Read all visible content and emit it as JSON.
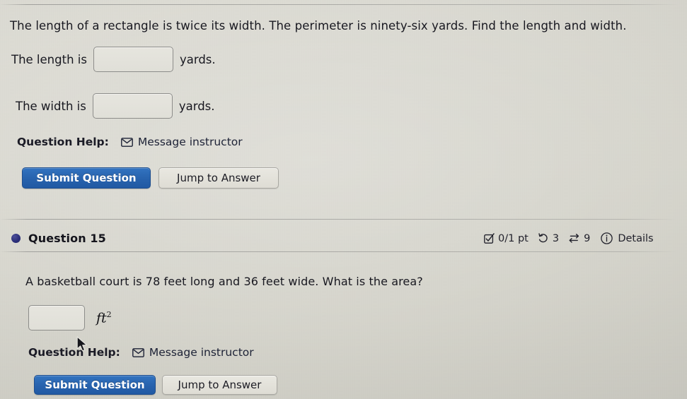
{
  "app": {
    "background_color": "#d7d6ce",
    "primary_button_color": "#2762ad",
    "bullet_color": "#2c2f7a"
  },
  "question_14": {
    "prompt": "The length of a rectangle is twice its width. The perimeter is ninety-six yards. Find the length and width.",
    "fields": [
      {
        "label_before": "The length is",
        "value": "",
        "placeholder": "",
        "label_after": "yards."
      },
      {
        "label_before": "The width is",
        "value": "",
        "placeholder": "",
        "label_after": "yards."
      }
    ],
    "help_label": "Question Help:",
    "message_instructor": "Message instructor",
    "message_icon": "envelope-icon",
    "submit_label": "Submit Question",
    "jump_label": "Jump to Answer"
  },
  "question_15": {
    "bullet_icon": "filled-circle-icon",
    "title": "Question 15",
    "meta": {
      "score_icon": "checkbox-checked-icon",
      "score": "0/1 pt",
      "attempts_icon": "rotate-left-icon",
      "attempts": "3",
      "versions_icon": "swap-arrows-icon",
      "versions": "9",
      "details_icon": "info-circle-icon",
      "details": "Details"
    },
    "prompt": "A basketball court is 78 feet long and 36 feet wide.  What is the area?",
    "answer": {
      "value": "",
      "placeholder": "",
      "unit": "ft",
      "unit_exponent": "2"
    },
    "help_label": "Question Help:",
    "message_instructor": "Message instructor",
    "message_icon": "envelope-icon",
    "submit_label": "Submit Question",
    "jump_label": "Jump to Answer"
  },
  "pointer": {
    "icon": "mouse-cursor-icon"
  }
}
